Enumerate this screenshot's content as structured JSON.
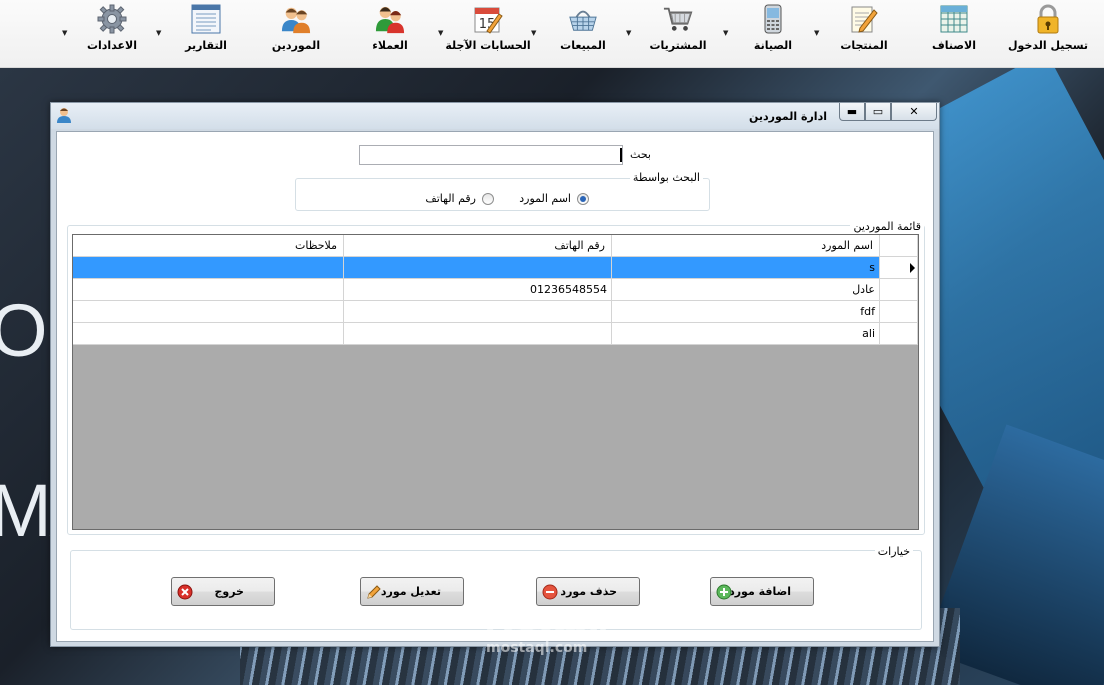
{
  "toolbar": {
    "items": [
      {
        "label": "تسجيل الدخول",
        "icon": "lock-icon"
      },
      {
        "label": "الاصناف",
        "icon": "grid-table-icon"
      },
      {
        "label": "المنتجات",
        "icon": "notepad-pencil-icon"
      },
      {
        "label": "الصيانة",
        "icon": "mobile-phone-icon"
      },
      {
        "label": "المشتريات",
        "icon": "shopping-cart-icon"
      },
      {
        "label": "المبيعات",
        "icon": "shopping-basket-icon"
      },
      {
        "label": "الحسابات الآجلة",
        "icon": "calendar-icon",
        "calendar_day": "15"
      },
      {
        "label": "العملاء",
        "icon": "customers-icon"
      },
      {
        "label": "الموردين",
        "icon": "suppliers-icon"
      },
      {
        "label": "التقارير",
        "icon": "report-icon"
      },
      {
        "label": "الاعدادات",
        "icon": "gear-icon"
      }
    ]
  },
  "background": {
    "text1": "OB",
    "text2": "MA"
  },
  "dialog": {
    "title": "ادارة الموردين",
    "controls": {
      "minimize": "▬",
      "maximize": "▭",
      "close": "✕"
    },
    "search": {
      "label": "بحث",
      "value": ""
    },
    "search_by": {
      "legend": "البحث بواسطة",
      "options": [
        {
          "label": "اسم المورد",
          "selected": true
        },
        {
          "label": "رقم الهاتف",
          "selected": false
        }
      ]
    },
    "grid": {
      "caption": "قائمة الموردين",
      "columns": [
        "اسم المورد",
        "رقم الهاتف",
        "ملاحظات"
      ],
      "rows": [
        {
          "name": "s",
          "phone": "",
          "notes": "",
          "selected": true
        },
        {
          "name": "عادل",
          "phone": "01236548554",
          "notes": ""
        },
        {
          "name": "fdf",
          "phone": "",
          "notes": ""
        },
        {
          "name": "ali",
          "phone": "",
          "notes": ""
        }
      ]
    },
    "options": {
      "legend": "خيارات",
      "add_label": "اضافة مورد",
      "delete_label": "حذف مورد",
      "edit_label": "تعديل مورد",
      "exit_label": "خروج"
    }
  },
  "watermark": {
    "arabic": "مستقل",
    "latin": "mostaql.com"
  },
  "colors": {
    "selection": "#3399ff",
    "grid_bg": "#ababab",
    "window_frame": "#cfd9e3"
  }
}
